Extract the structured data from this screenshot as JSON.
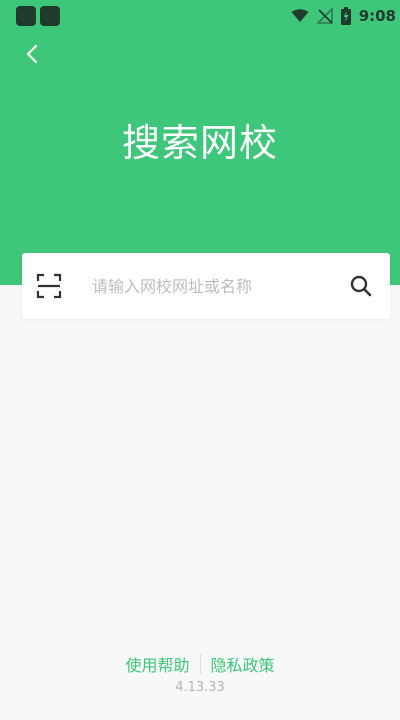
{
  "status_bar": {
    "time": "9:08"
  },
  "header": {
    "title": "搜索网校",
    "back_icon": "chevron-left-icon"
  },
  "search": {
    "placeholder": "请输入网校网址或名称",
    "value": "",
    "scan_icon": "scan-icon",
    "search_icon": "search-icon"
  },
  "footer": {
    "help_label": "使用帮助",
    "privacy_label": "隐私政策",
    "version": "4.13.33"
  },
  "colors": {
    "brand_green": "#3ec67a",
    "background": "#f8f8f8",
    "placeholder": "#bdbdbd"
  }
}
